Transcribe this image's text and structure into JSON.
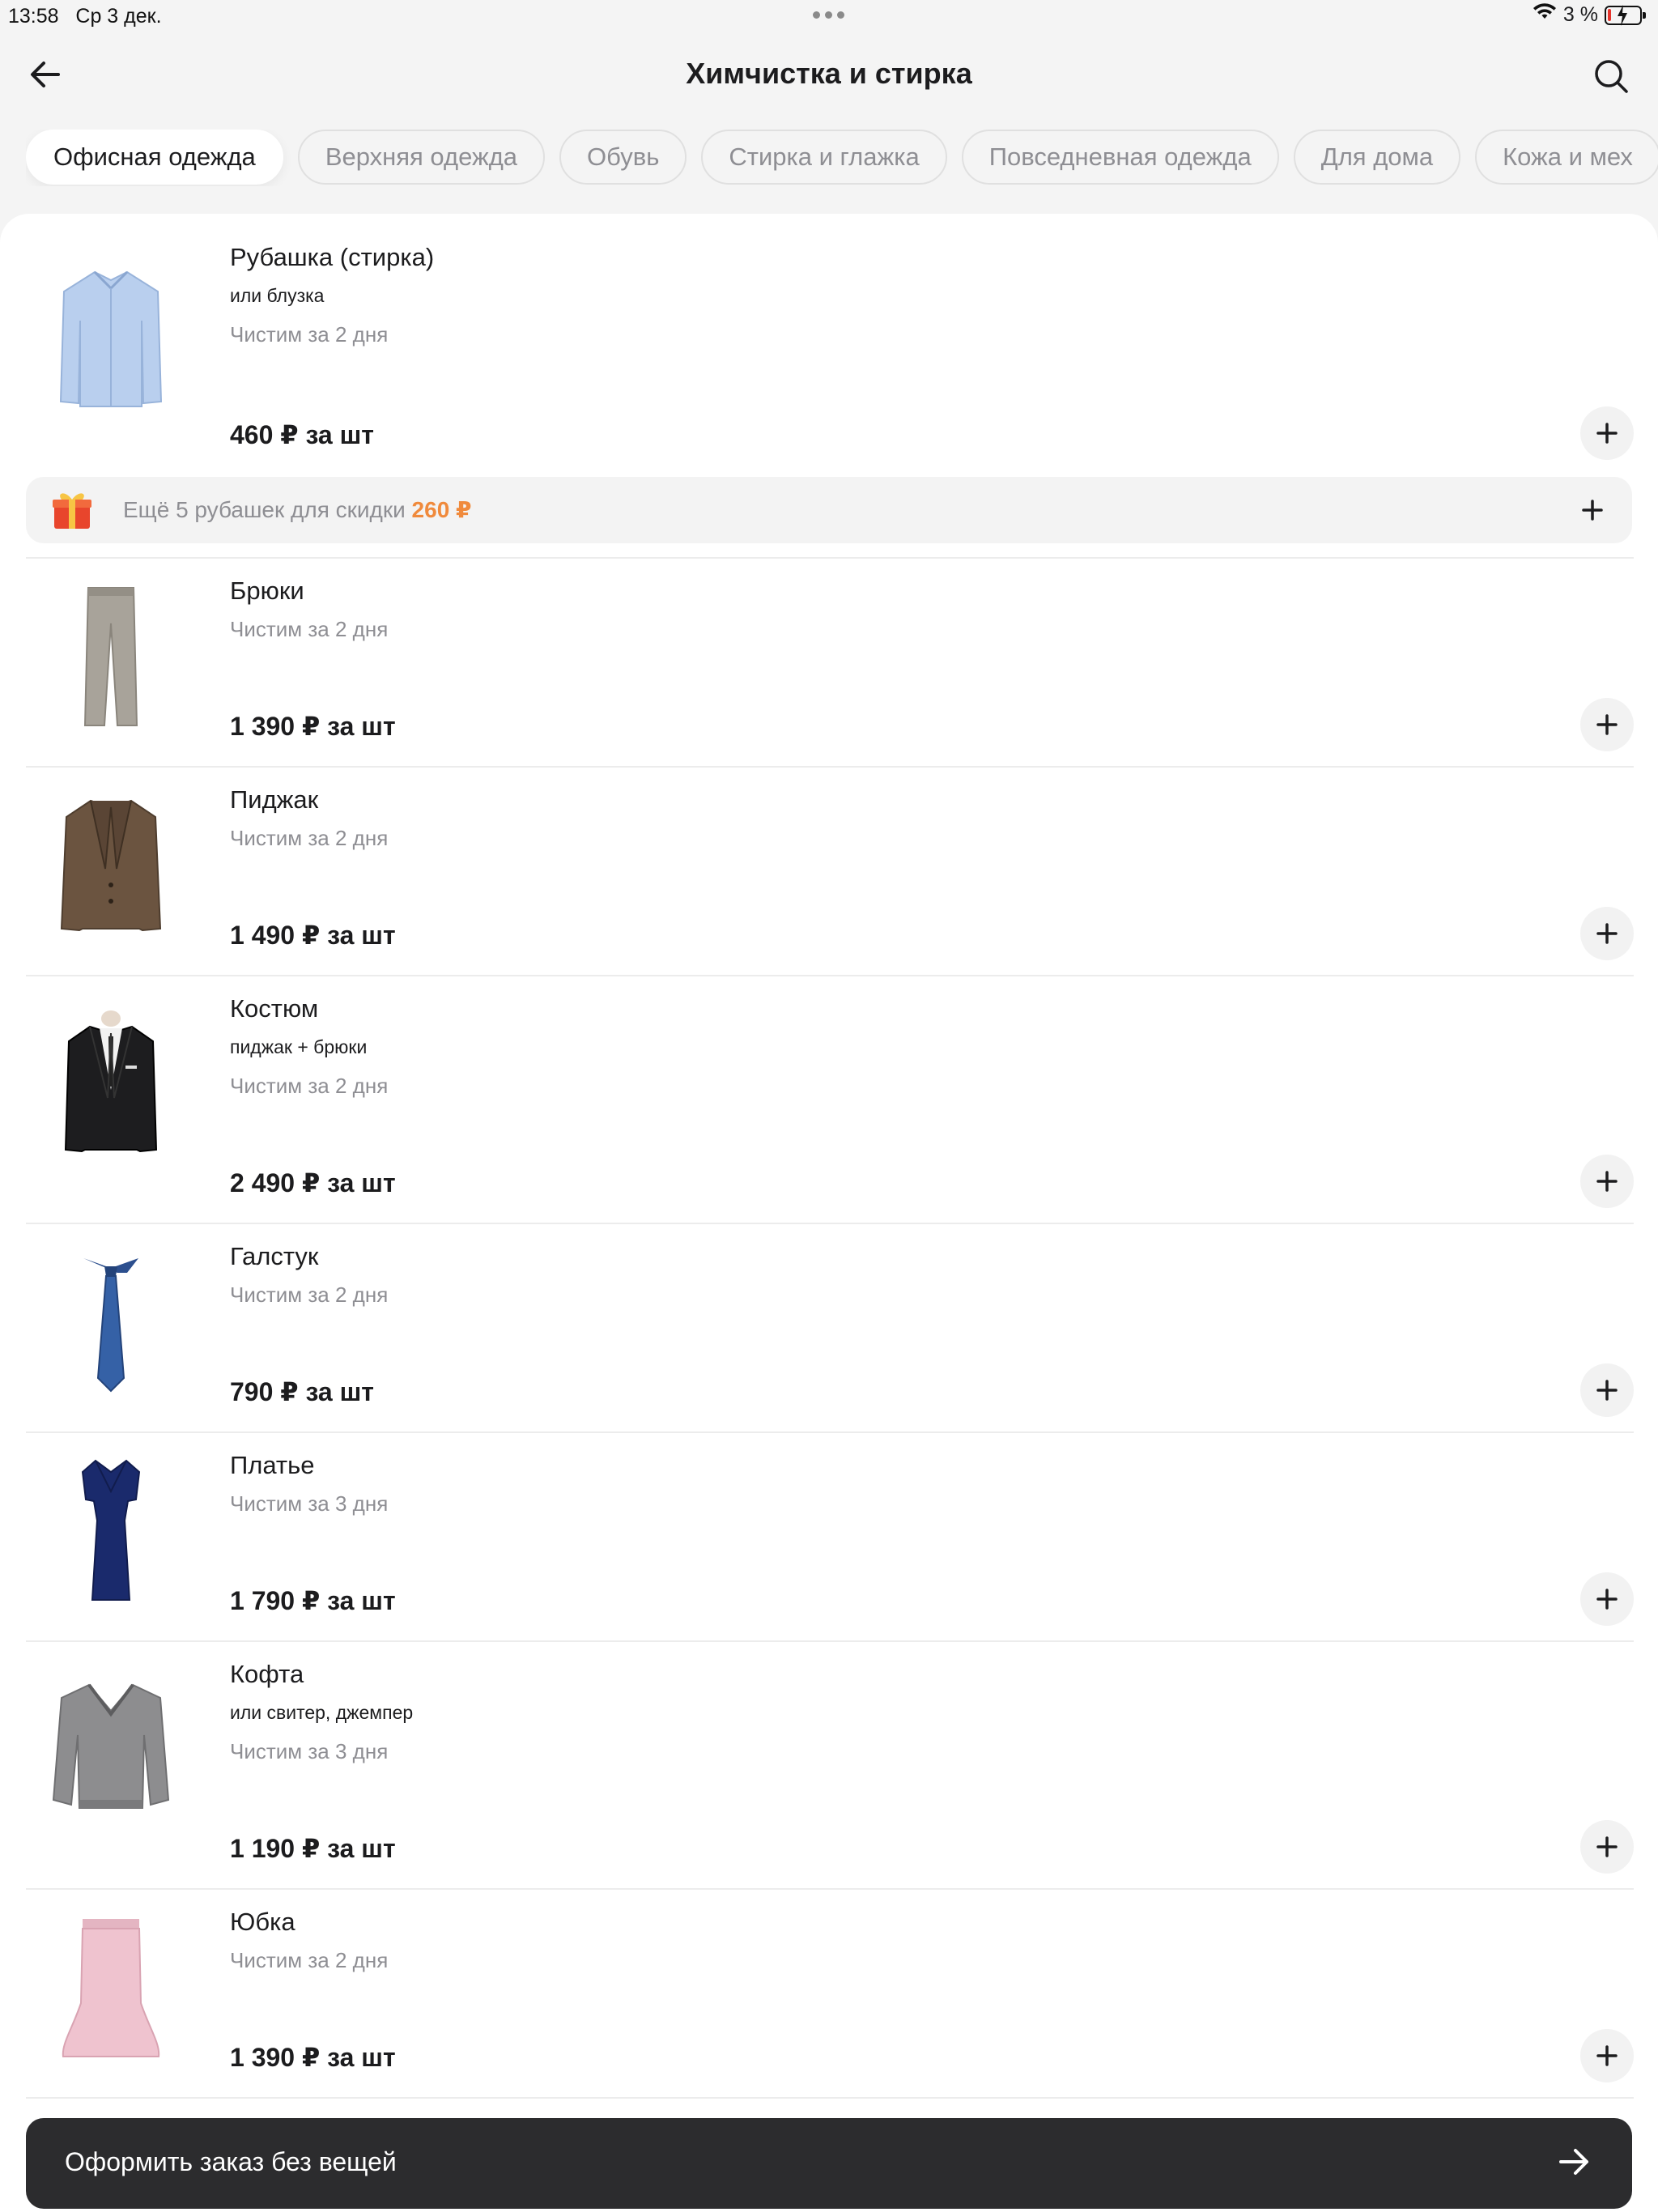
{
  "status_bar": {
    "time": "13:58",
    "date": "Ср 3 дек.",
    "battery": "3 %"
  },
  "header": {
    "title": "Химчистка и стирка",
    "back_icon": "arrow-left-icon",
    "search_icon": "search-icon"
  },
  "tabs": [
    {
      "label": "Офисная одежда",
      "active": true
    },
    {
      "label": "Верхняя одежда",
      "active": false
    },
    {
      "label": "Обувь",
      "active": false
    },
    {
      "label": "Стирка и глажка",
      "active": false
    },
    {
      "label": "Повседневная одежда",
      "active": false
    },
    {
      "label": "Для дома",
      "active": false
    },
    {
      "label": "Кожа и мех",
      "active": false
    }
  ],
  "items": [
    {
      "title": "Рубашка (стирка)",
      "subtitle": "или блузка",
      "term": "Чистим за 2 дня",
      "price": "460 ₽ за шт",
      "icon": "shirt-icon"
    },
    {
      "title": "Брюки",
      "subtitle": "",
      "term": "Чистим за 2 дня",
      "price": "1 390 ₽ за шт",
      "icon": "trousers-icon"
    },
    {
      "title": "Пиджак",
      "subtitle": "",
      "term": "Чистим за 2 дня",
      "price": "1 490 ₽ за шт",
      "icon": "blazer-icon"
    },
    {
      "title": "Костюм",
      "subtitle": "пиджак + брюки",
      "term": "Чистим за 2 дня",
      "price": "2 490 ₽ за шт",
      "icon": "suit-icon"
    },
    {
      "title": "Галстук",
      "subtitle": "",
      "term": "Чистим за 2 дня",
      "price": "790 ₽ за шт",
      "icon": "tie-icon"
    },
    {
      "title": "Платье",
      "subtitle": "",
      "term": "Чистим за 3 дня",
      "price": "1 790 ₽ за шт",
      "icon": "dress-icon"
    },
    {
      "title": "Кофта",
      "subtitle": "или свитер, джемпер",
      "term": "Чистим за 3 дня",
      "price": "1 190 ₽ за шт",
      "icon": "sweater-icon"
    },
    {
      "title": "Юбка",
      "subtitle": "",
      "term": "Чистим за 2 дня",
      "price": "1 390 ₽ за шт",
      "icon": "skirt-icon"
    }
  ],
  "promo": {
    "text": "Ещё 5 рубашек для скидки",
    "amount": "260 ₽",
    "amount_color": "#f08a3c",
    "icon": "gift-icon"
  },
  "checkout": {
    "label": "Оформить заказ без вещей",
    "icon": "arrow-right-icon"
  },
  "colors": {
    "background": "#f4f4f4",
    "card": "#ffffff",
    "button_dark": "#2c2c2e",
    "muted_text": "#8e8e93"
  }
}
